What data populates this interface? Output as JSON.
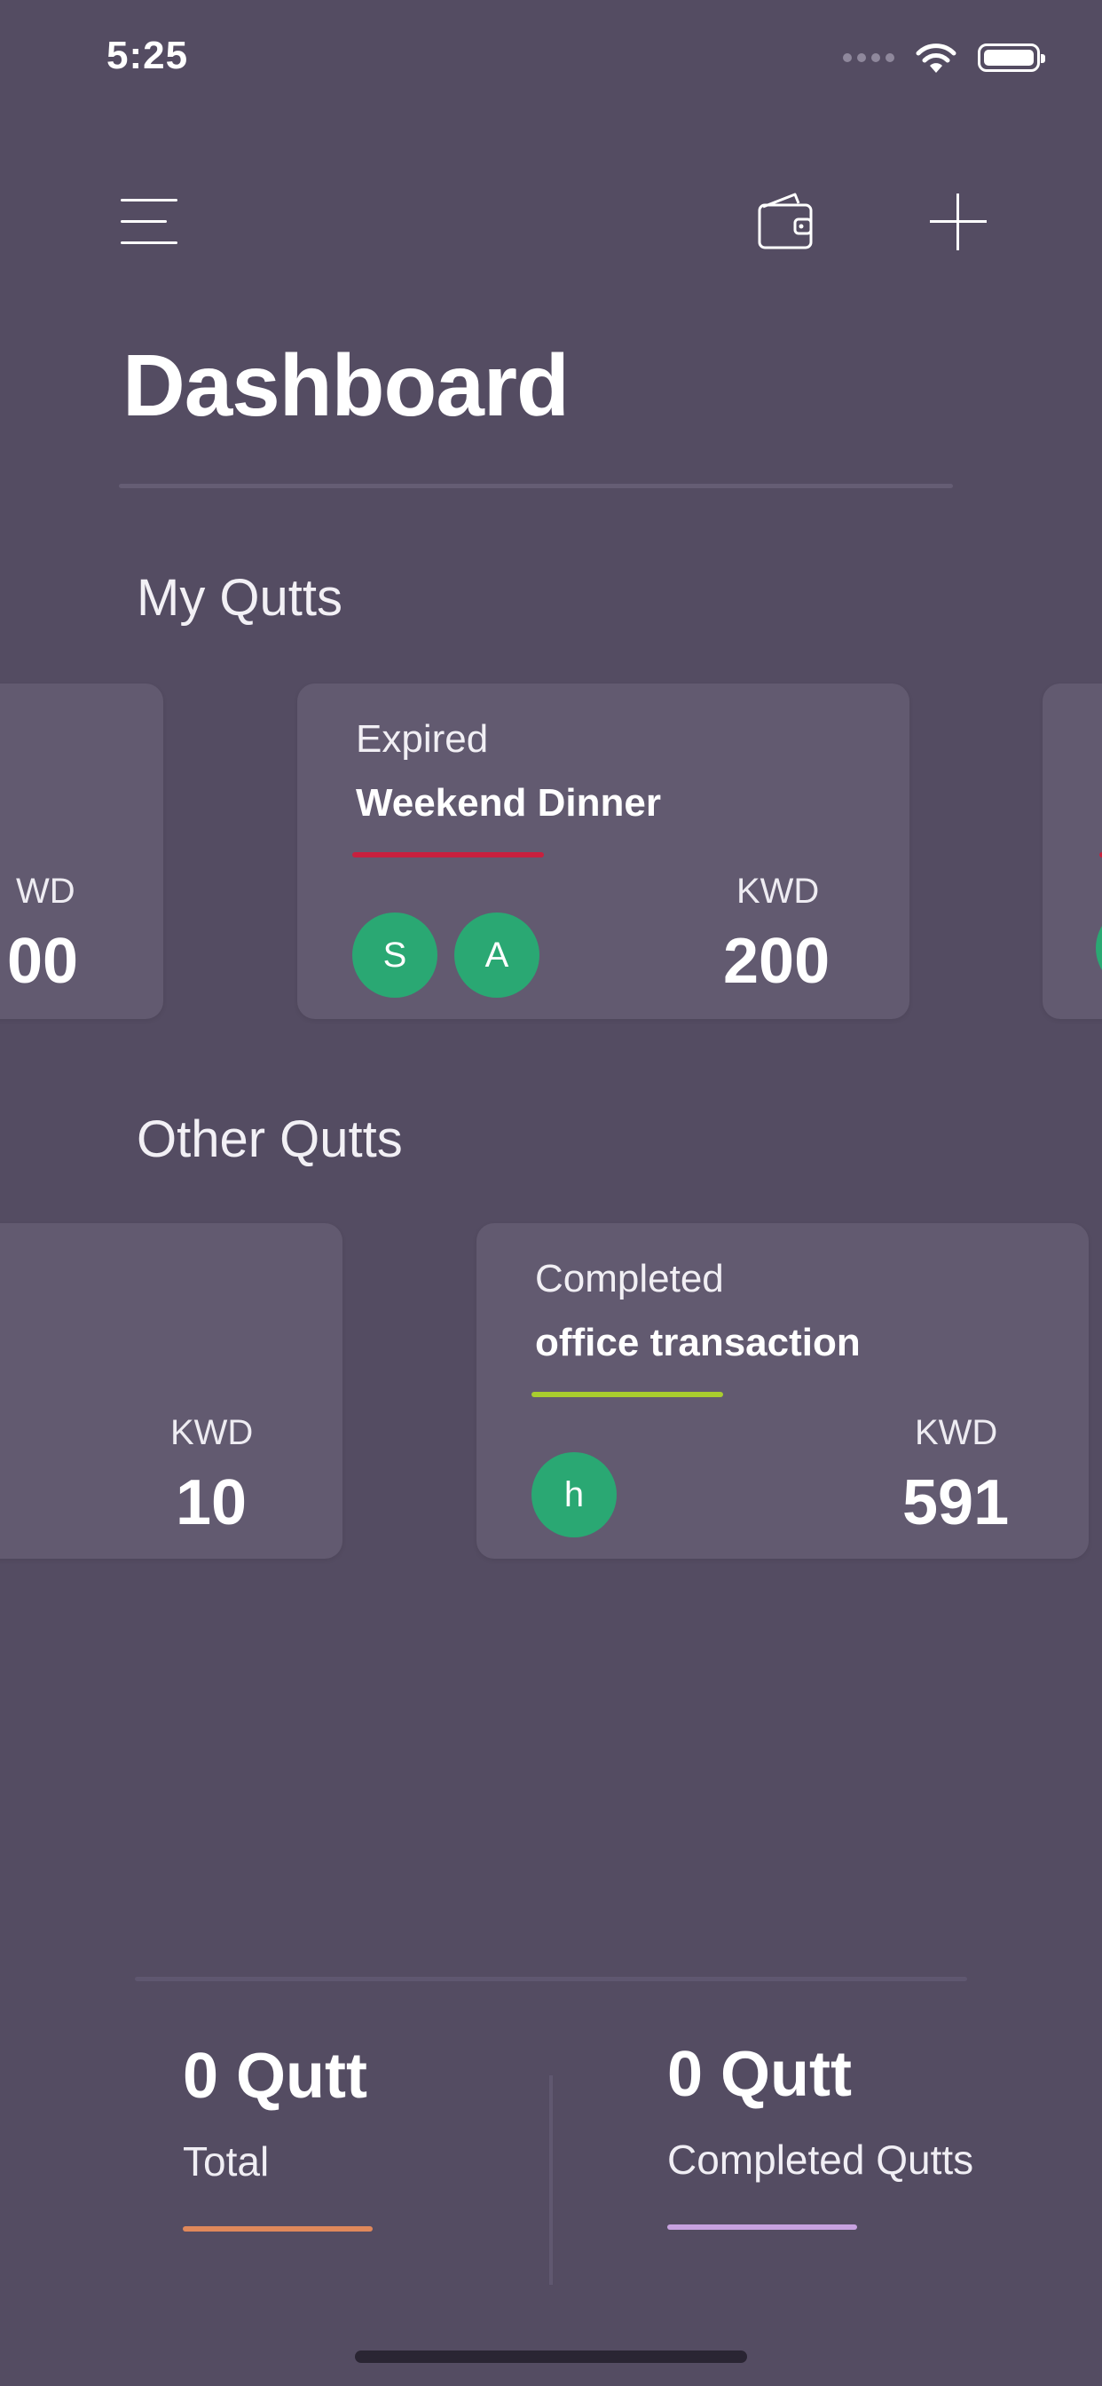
{
  "status_bar": {
    "time": "5:25"
  },
  "header": {
    "title": "Dashboard"
  },
  "my_qutts": {
    "section_title": "My Qutts",
    "cards": [
      {
        "currency": "WD",
        "amount": "00"
      },
      {
        "status": "Expired",
        "name": "Weekend Dinner",
        "accent": "#c8203e",
        "avatars": [
          "S",
          "A"
        ],
        "currency": "KWD",
        "amount": "200"
      },
      {
        "accent": "#c8203e"
      }
    ]
  },
  "other_qutts": {
    "section_title": "Other Qutts",
    "cards": [
      {
        "currency": "KWD",
        "amount": "10"
      },
      {
        "status": "Completed",
        "name": "office transaction",
        "accent": "#a9cd2e",
        "avatars": [
          "h"
        ],
        "currency": "KWD",
        "amount": "591"
      }
    ]
  },
  "summary": {
    "total": {
      "value": "0 Qutt",
      "label": "Total",
      "accent": "#e0885a"
    },
    "completed": {
      "value": "0 Qutt",
      "label": "Completed Qutts",
      "accent": "#c8a2e0"
    }
  },
  "icons": {
    "menu": "hamburger-menu-icon",
    "wallet": "wallet-icon",
    "add": "plus-icon",
    "wifi": "wifi-icon",
    "battery": "battery-icon"
  }
}
